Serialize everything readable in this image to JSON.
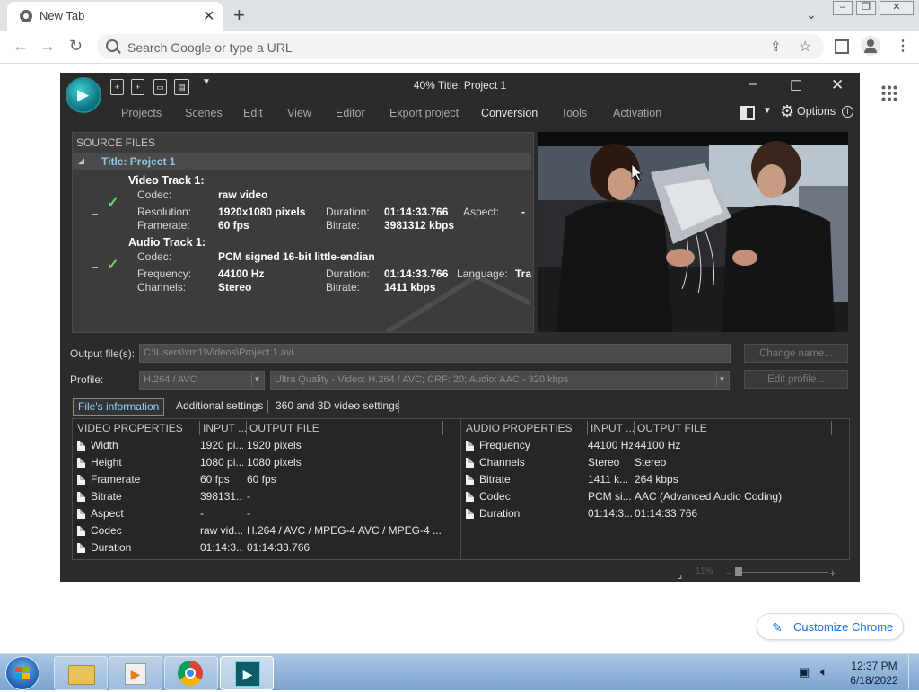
{
  "browser": {
    "tab_title": "New Tab",
    "omnibox_placeholder": "Search Google or type a URL",
    "customize_label": "Customize Chrome"
  },
  "app": {
    "window_title": "40% Title: Project 1",
    "menu": [
      "Projects",
      "Scenes",
      "Edit",
      "View",
      "Editor",
      "Export project",
      "Conversion",
      "Tools",
      "Activation"
    ],
    "active_menu": "Conversion",
    "options_label": "Options",
    "source_files": {
      "header": "SOURCE FILES",
      "project_title": "Title: Project 1",
      "video_track": {
        "title": "Video Track 1:",
        "codec_label": "Codec:",
        "codec": "raw video",
        "resolution_label": "Resolution:",
        "resolution": "1920x1080 pixels",
        "duration_label": "Duration:",
        "duration": "01:14:33.766",
        "aspect_label": "Aspect:",
        "aspect": "-",
        "framerate_label": "Framerate:",
        "framerate": "60 fps",
        "bitrate_label": "Bitrate:",
        "bitrate": "3981312 kbps"
      },
      "audio_track": {
        "title": "Audio Track 1:",
        "codec_label": "Codec:",
        "codec": "PCM signed 16-bit little-endian",
        "frequency_label": "Frequency:",
        "frequency": "44100 Hz",
        "duration_label": "Duration:",
        "duration": "01:14:33.766",
        "language_label": "Language:",
        "language": "Tra",
        "channels_label": "Channels:",
        "channels": "Stereo",
        "bitrate_label": "Bitrate:",
        "bitrate": "1411 kbps"
      }
    },
    "output": {
      "label": "Output file(s):",
      "path": "C:\\Users\\vm1\\Videos\\Project 1.avi",
      "change_name": "Change name...",
      "profile_label": "Profile:",
      "profile_codec": "H.264 / AVC",
      "profile_preset": "Ultra Quality - Video: H.264 / AVC; CRF: 20; Audio: AAC - 320 kbps",
      "edit_profile": "Edit profile..."
    },
    "tabs": [
      "File's information",
      "Additional settings",
      "360 and 3D video settings"
    ],
    "video_table": {
      "headers": [
        "VIDEO PROPERTIES",
        "INPUT ...",
        "OUTPUT FILE"
      ],
      "rows": [
        [
          "Width",
          "1920 pi...",
          "1920 pixels"
        ],
        [
          "Height",
          "1080 pi...",
          "1080 pixels"
        ],
        [
          "Framerate",
          "60 fps",
          "60 fps"
        ],
        [
          "Bitrate",
          "398131...",
          "-"
        ],
        [
          "Aspect",
          "-",
          "-"
        ],
        [
          "Codec",
          "raw vid...",
          "H.264 / AVC / MPEG-4 AVC / MPEG-4 ..."
        ],
        [
          "Duration",
          "01:14:3...",
          "01:14:33.766"
        ]
      ]
    },
    "audio_table": {
      "headers": [
        "AUDIO PROPERTIES",
        "INPUT ...",
        "OUTPUT FILE"
      ],
      "rows": [
        [
          "Frequency",
          "44100 Hz",
          "44100 Hz"
        ],
        [
          "Channels",
          "Stereo",
          "Stereo"
        ],
        [
          "Bitrate",
          "1411 k...",
          "264 kbps"
        ],
        [
          "Codec",
          "PCM si...",
          "AAC (Advanced Audio Coding)"
        ],
        [
          "Duration",
          "01:14:3...",
          "01:14:33.766"
        ]
      ]
    },
    "zoom_label": "11%"
  },
  "taskbar": {
    "time": "12:37 PM",
    "date": "6/18/2022"
  }
}
